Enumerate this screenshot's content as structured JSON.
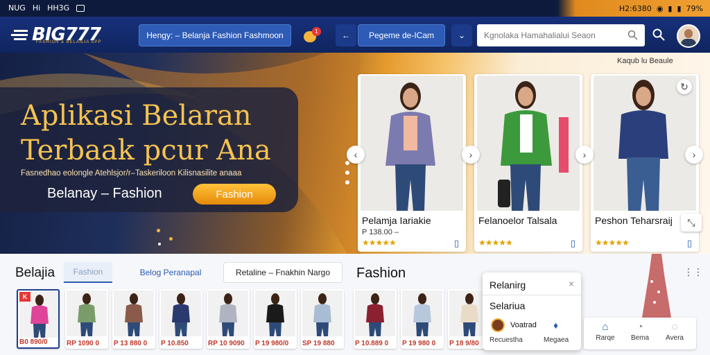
{
  "status_bar": {
    "left_items": [
      "NUG",
      "Hi",
      "HH3G"
    ],
    "time": "H2:6380",
    "battery": "79%"
  },
  "header": {
    "logo_text": "BIG777",
    "logo_tagline": "FASHION & BELANJA APP",
    "category_button": "Hengy: – Belanja Fashion Fashmoon",
    "notification_count": "1",
    "secondary_button": "Pegeme de-ICam",
    "search_placeholder": "Kgnolaka Hamahalialui Seaon",
    "search_icon": "search-icon",
    "profile_icon": "avatar"
  },
  "hero": {
    "corner_label": "Kaqub lu Beaule",
    "title_line1": "Aplikasi Belaran",
    "title_line2": "Terbaak pcur Ana",
    "subtitle": "Fasnedhao eolongle Atehlsjor/r–Taskeriloon Kilisnasilite anaaa",
    "label": "Belanay – Fashion",
    "button": "Fashion"
  },
  "products": [
    {
      "name": "Pelamja Iariakie",
      "price": "P 138.00 –",
      "rating": "★★★★★"
    },
    {
      "name": "Felanoelor Talsala",
      "price": "",
      "rating": "★★★★★"
    },
    {
      "name": "Peshon Teharsraij",
      "price": "",
      "rating": "★★★★★"
    }
  ],
  "bottom": {
    "section_title": "Belajia",
    "tab_active": "Fashion",
    "tab_2": "Belog Peranapal",
    "tab_3": "Retaline – Fnakhin  Nargo",
    "fashion_title": "Fashion",
    "thumbs": [
      {
        "price": "B0 890/0",
        "badge": "K"
      },
      {
        "price": "RP 1090 0"
      },
      {
        "price": "P 13 880 0"
      },
      {
        "price": "P 10.850"
      },
      {
        "price": "RP 10 9090"
      },
      {
        "price": "P 19 980/0"
      },
      {
        "price": "SP 19 880"
      },
      {
        "price": "P 10.889 0"
      },
      {
        "price": "P 19 980 0"
      },
      {
        "price": "P 18 9/80"
      }
    ]
  },
  "popup": {
    "title": "Relanirg",
    "subtitle": "Selariua",
    "user_name": "Voatrad",
    "label_left": "Recuestha",
    "label_right": "Megaea"
  },
  "bottom_nav": [
    {
      "label": "Rarqe"
    },
    {
      "label": "Bema"
    },
    {
      "label": "Avera"
    }
  ],
  "colors": {
    "nav_bg": "#17307a",
    "accent": "#f5c350",
    "button_orange": "#f0a02a",
    "link_blue": "#2a5db0"
  }
}
